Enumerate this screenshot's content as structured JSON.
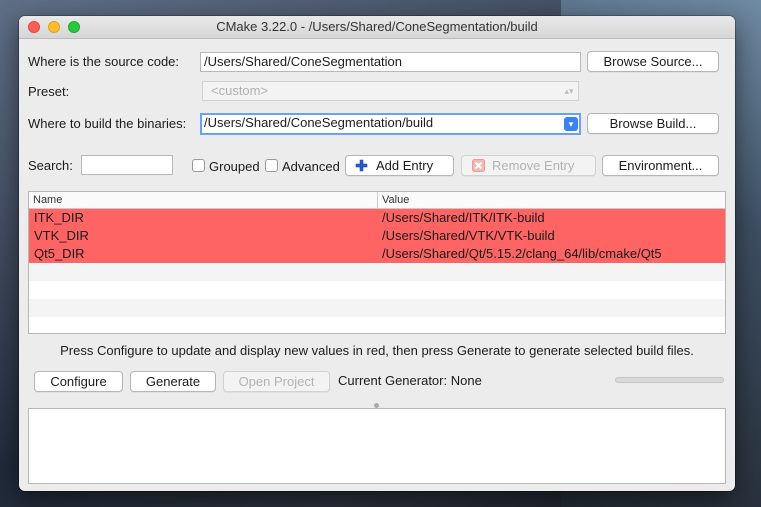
{
  "window": {
    "title": "CMake 3.22.0 - /Users/Shared/ConeSegmentation/build"
  },
  "source": {
    "label": "Where is the source code:",
    "value": "/Users/Shared/ConeSegmentation",
    "browse_label": "Browse Source..."
  },
  "preset": {
    "label": "Preset:",
    "value": "<custom>"
  },
  "build": {
    "label": "Where to build the binaries:",
    "value": "/Users/Shared/ConeSegmentation/build",
    "browse_label": "Browse Build..."
  },
  "toolbar": {
    "search_label": "Search:",
    "search_value": "",
    "grouped_label": "Grouped",
    "advanced_label": "Advanced",
    "add_entry_label": "Add Entry",
    "remove_entry_label": "Remove Entry",
    "environment_label": "Environment..."
  },
  "table": {
    "columns": [
      "Name",
      "Value"
    ],
    "rows": [
      {
        "name": "ITK_DIR",
        "value": "/Users/Shared/ITK/ITK-build"
      },
      {
        "name": "VTK_DIR",
        "value": "/Users/Shared/VTK/VTK-build"
      },
      {
        "name": "Qt5_DIR",
        "value": "/Users/Shared/Qt/5.15.2/clang_64/lib/cmake/Qt5"
      }
    ]
  },
  "hint": "Press Configure to update and display new values in red, then press Generate to generate selected build files.",
  "actions": {
    "configure_label": "Configure",
    "generate_label": "Generate",
    "open_project_label": "Open Project",
    "generator_text": "Current Generator: None"
  },
  "colors": {
    "new_value_row": "#ff6464",
    "focus": "#6ba1f2",
    "add_icon": "#2a5bd7",
    "remove_icon": "#f08a8a"
  }
}
